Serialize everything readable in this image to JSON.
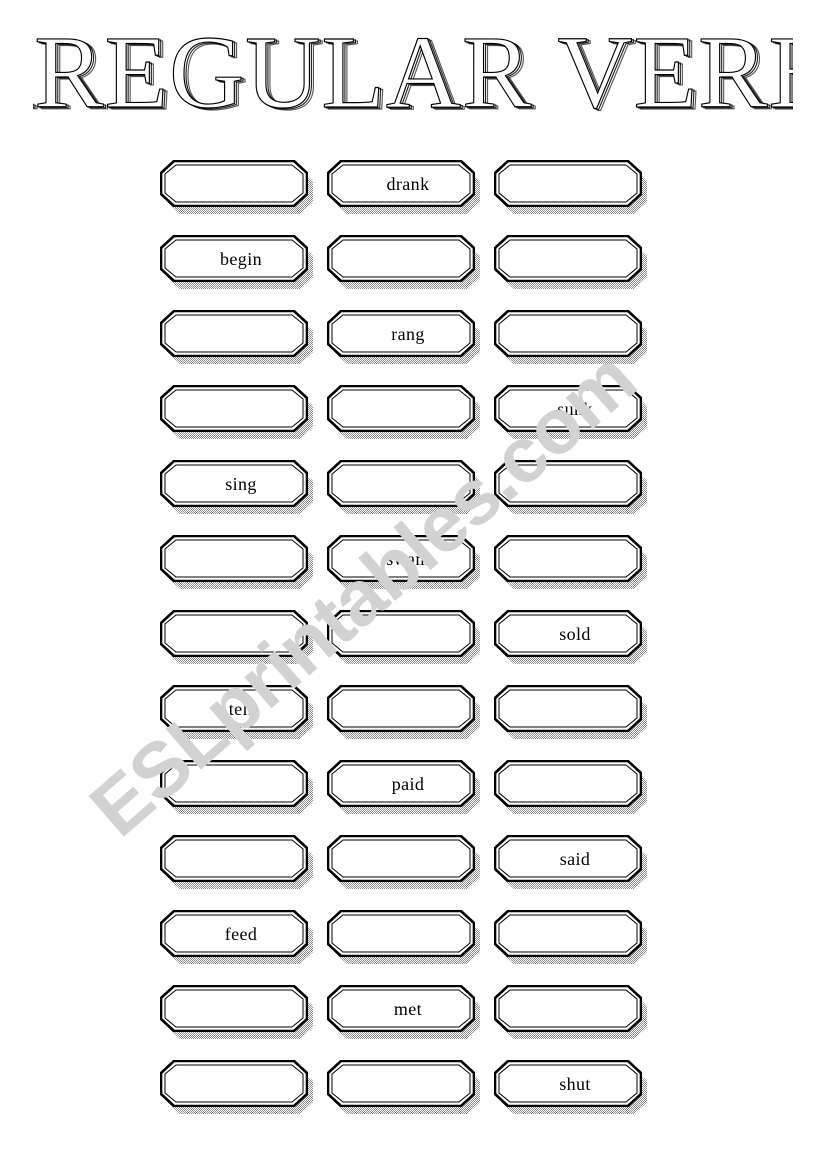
{
  "page": {
    "title": "IRREGULAR VERBS",
    "background_color": "#ffffff",
    "ink_color": "#000000",
    "shadow_color": "#9e9e9e"
  },
  "header": {
    "heading": "IRREGULAR VERBS"
  },
  "watermark": {
    "text": "ESLprintables.com",
    "color": "#d2d2d2"
  },
  "grid": {
    "columns": 3,
    "rows": 13,
    "cells": [
      [
        {
          "id": "r1c1",
          "label": "",
          "filled": false
        },
        {
          "id": "r1c2",
          "label": "drank",
          "filled": true
        },
        {
          "id": "r1c3",
          "label": "",
          "filled": false
        }
      ],
      [
        {
          "id": "r2c1",
          "label": "begin",
          "filled": true
        },
        {
          "id": "r2c2",
          "label": "",
          "filled": false
        },
        {
          "id": "r2c3",
          "label": "",
          "filled": false
        }
      ],
      [
        {
          "id": "r3c1",
          "label": "",
          "filled": false
        },
        {
          "id": "r3c2",
          "label": "rang",
          "filled": true
        },
        {
          "id": "r3c3",
          "label": "",
          "filled": false
        }
      ],
      [
        {
          "id": "r4c1",
          "label": "",
          "filled": false
        },
        {
          "id": "r4c2",
          "label": "",
          "filled": false
        },
        {
          "id": "r4c3",
          "label": "sunk",
          "filled": true
        }
      ],
      [
        {
          "id": "r5c1",
          "label": "sing",
          "filled": true
        },
        {
          "id": "r5c2",
          "label": "",
          "filled": false
        },
        {
          "id": "r5c3",
          "label": "",
          "filled": false
        }
      ],
      [
        {
          "id": "r6c1",
          "label": "",
          "filled": false
        },
        {
          "id": "r6c2",
          "label": "swam",
          "filled": true
        },
        {
          "id": "r6c3",
          "label": "",
          "filled": false
        }
      ],
      [
        {
          "id": "r7c1",
          "label": "",
          "filled": false
        },
        {
          "id": "r7c2",
          "label": "",
          "filled": false
        },
        {
          "id": "r7c3",
          "label": "sold",
          "filled": true
        }
      ],
      [
        {
          "id": "r8c1",
          "label": "tell",
          "filled": true
        },
        {
          "id": "r8c2",
          "label": "",
          "filled": false
        },
        {
          "id": "r8c3",
          "label": "",
          "filled": false
        }
      ],
      [
        {
          "id": "r9c1",
          "label": "",
          "filled": false
        },
        {
          "id": "r9c2",
          "label": "paid",
          "filled": true
        },
        {
          "id": "r9c3",
          "label": "",
          "filled": false
        }
      ],
      [
        {
          "id": "r10c1",
          "label": "",
          "filled": false
        },
        {
          "id": "r10c2",
          "label": "",
          "filled": false
        },
        {
          "id": "r10c3",
          "label": "said",
          "filled": true
        }
      ],
      [
        {
          "id": "r11c1",
          "label": "feed",
          "filled": true
        },
        {
          "id": "r11c2",
          "label": "",
          "filled": false
        },
        {
          "id": "r11c3",
          "label": "",
          "filled": false
        }
      ],
      [
        {
          "id": "r12c1",
          "label": "",
          "filled": false
        },
        {
          "id": "r12c2",
          "label": "met",
          "filled": true
        },
        {
          "id": "r12c3",
          "label": "",
          "filled": false
        }
      ],
      [
        {
          "id": "r13c1",
          "label": "",
          "filled": false
        },
        {
          "id": "r13c2",
          "label": "",
          "filled": false
        },
        {
          "id": "r13c3",
          "label": "shut",
          "filled": true
        }
      ]
    ]
  }
}
